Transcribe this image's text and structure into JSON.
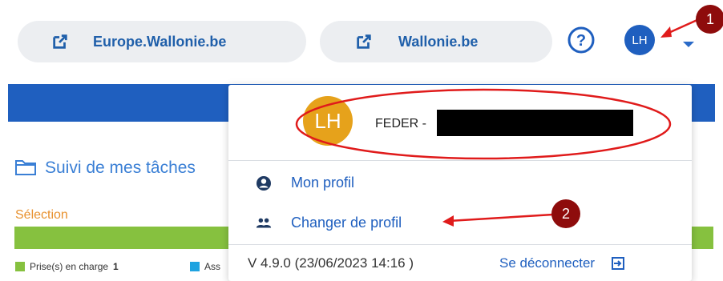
{
  "header": {
    "links": [
      {
        "label": "Europe.Wallonie.be",
        "icon": "external-link-icon"
      },
      {
        "label": "Wallonie.be",
        "icon": "external-link-icon"
      }
    ],
    "help_icon": "question-circle-icon",
    "avatar_initials": "LH",
    "dropdown_icon": "caret-down-icon"
  },
  "background": {
    "task_title": "Suivi de mes tâches",
    "selection_label": "Sélection",
    "legend": [
      {
        "label": "Prise(s) en charge",
        "count": "1",
        "color": "#86c13f"
      },
      {
        "label": "Ass",
        "color": "#1fa3e0"
      }
    ]
  },
  "dropdown": {
    "avatar_initials": "LH",
    "user_prefix": "FEDER -",
    "menu": [
      {
        "label": "Mon profil",
        "icon": "user-circle-icon"
      },
      {
        "label": "Changer de profil",
        "icon": "users-icon"
      }
    ],
    "version": "V 4.9.0 (23/06/2023 14:16 )",
    "logout_label": "Se déconnecter",
    "logout_icon": "sign-out-icon"
  },
  "annotations": {
    "badge1": "1",
    "badge2": "2",
    "color": "#e01b1b"
  },
  "colors": {
    "accent": "#1f5fbf",
    "orange": "#e8912e",
    "green": "#86c13f",
    "badge": "#8e0c0c"
  }
}
